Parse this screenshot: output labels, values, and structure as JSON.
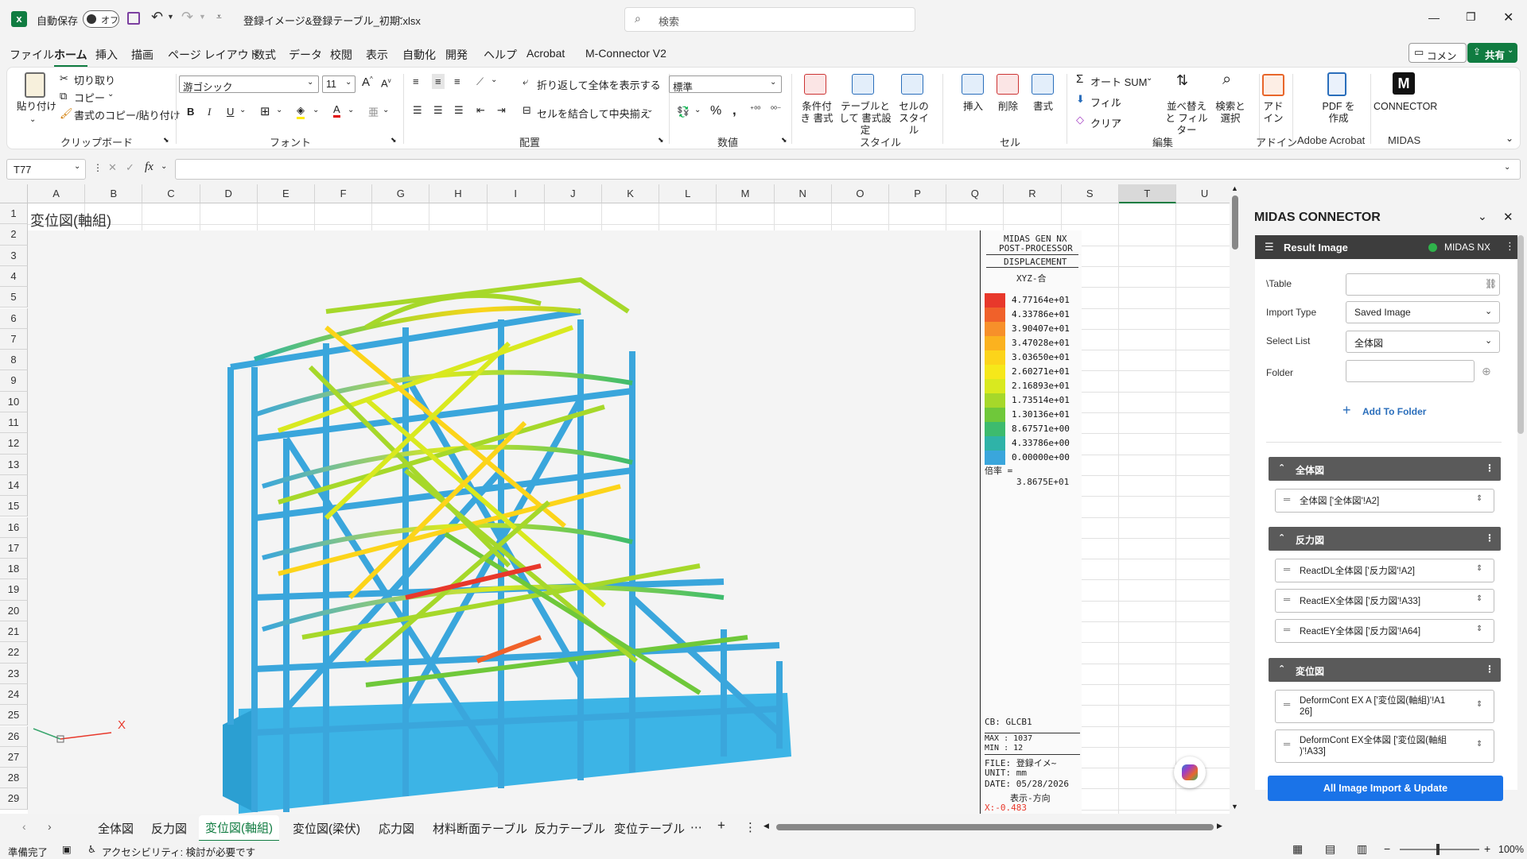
{
  "titlebar": {
    "autosave_label": "自動保存",
    "autosave_toggle": "オフ",
    "file_name": "登録イメージ&登録テーブル_初期.xlsx",
    "search_placeholder": "検索"
  },
  "menu": [
    "ファイル",
    "ホーム",
    "挿入",
    "描画",
    "ページ レイアウト",
    "数式",
    "データ",
    "校閲",
    "表示",
    "自動化",
    "開発",
    "ヘルプ",
    "Acrobat",
    "M-Connector V2"
  ],
  "menu_right": {
    "comment": "コメント",
    "share": "共有"
  },
  "ribbon": {
    "clipboard": {
      "paste": "貼り付け",
      "cut": "切り取り",
      "copy": "コピー",
      "format_painter": "書式のコピー/貼り付け",
      "label": "クリップボード"
    },
    "font": {
      "name": "游ゴシック",
      "size": "11",
      "label": "フォント"
    },
    "alignment": {
      "wrap": "折り返して全体を表示する",
      "merge": "セルを結合して中央揃え",
      "label": "配置"
    },
    "number": {
      "format": "標準",
      "label": "数値"
    },
    "styles": {
      "conditional": "条件付き 書式",
      "table": "テーブルとして 書式設定",
      "cell": "セルの スタイル",
      "label": "スタイル"
    },
    "cells": {
      "insert": "挿入",
      "delete": "削除",
      "format": "書式",
      "label": "セル"
    },
    "editing": {
      "autosum": "オート SUM",
      "fill": "フィル",
      "clear": "クリア",
      "sort": "並べ替えと フィルター",
      "find": "検索と 選択",
      "label": "編集"
    },
    "addin": {
      "addins": "アド イン",
      "label": "アドイン"
    },
    "acrobat": {
      "pdf": "PDF を作成",
      "label": "Adobe Acrobat"
    },
    "midas": {
      "connector": "CONNECTOR",
      "label": "MIDAS"
    }
  },
  "formula": {
    "namebox": "T77",
    "value": ""
  },
  "columns": [
    "A",
    "B",
    "C",
    "D",
    "E",
    "F",
    "G",
    "H",
    "I",
    "J",
    "K",
    "L",
    "M",
    "N",
    "O",
    "P",
    "Q",
    "R",
    "S",
    "T",
    "U"
  ],
  "rows": [
    "1",
    "2",
    "3",
    "4",
    "5",
    "6",
    "7",
    "8",
    "9",
    "10",
    "11",
    "12",
    "13",
    "14",
    "15",
    "16",
    "17",
    "18",
    "19",
    "20",
    "21",
    "22",
    "23",
    "24",
    "25",
    "26",
    "27",
    "28",
    "29"
  ],
  "cell_a1": "変位図(軸組)",
  "legend": {
    "header": [
      "MIDAS GEN NX",
      "POST-PROCESSOR"
    ],
    "type": "DISPLACEMENT",
    "component": "XYZ-合",
    "values": [
      "4.77164e+01",
      "4.33786e+01",
      "3.90407e+01",
      "3.47028e+01",
      "3.03650e+01",
      "2.60271e+01",
      "2.16893e+01",
      "1.73514e+01",
      "1.30136e+01",
      "8.67571e+00",
      "4.33786e+00",
      "0.00000e+00"
    ],
    "colors": [
      "#e8382b",
      "#f0612a",
      "#f7902a",
      "#fbb21f",
      "#fcd41a",
      "#f6e81a",
      "#d9e91f",
      "#a6d82a",
      "#6fc83a",
      "#3dbb6e",
      "#2fb3a8",
      "#3aa6dc"
    ],
    "scale_label": "倍率 =",
    "scale_value": "3.8675E+01",
    "cb": "CB: GLCB1",
    "max": "MAX : 1037",
    "min": "MIN : 12",
    "file": "FILE: 登録イメ~",
    "unit": "UNIT: mm",
    "date": "DATE: 05/28/2026",
    "view_dir": "表示-方向",
    "x_val": "X:-0.483"
  },
  "axis_label": "X",
  "tabs": [
    "全体図",
    "反力図",
    "変位図(軸組)",
    "変位図(梁伏)",
    "応力図",
    "材料断面テーブル",
    "反力テーブル",
    "変位テーブル"
  ],
  "active_tab": "変位図(軸組)",
  "status": {
    "ready": "準備完了",
    "accessibility": "アクセシビリティ: 検討が必要です",
    "zoom": "100%"
  },
  "panel": {
    "title": "MIDAS CONNECTOR",
    "header": "Result Image",
    "badge": "MIDAS NX",
    "table_label": "\\Table",
    "table_value": "",
    "import_type_label": "Import Type",
    "import_type_value": "Saved Image",
    "select_list_label": "Select List",
    "select_list_value": "全体図",
    "folder_label": "Folder",
    "folder_value": "",
    "add_folder": "Add To Folder",
    "sections": [
      {
        "name": "全体図",
        "items": [
          "全体図 ['全体図'!A2]"
        ]
      },
      {
        "name": "反力図",
        "items": [
          "ReactDL全体図 ['反力図'!A2]",
          "ReactEX全体図 ['反力図'!A33]",
          "ReactEY全体図 ['反力図'!A64]"
        ]
      },
      {
        "name": "変位図",
        "items": [
          "DeformCont EX A ['変位図(軸組)'!A1 26]",
          "DeformCont EX全体図 ['変位図(軸組 )'!A33]"
        ]
      }
    ],
    "import_button": "All Image Import & Update"
  }
}
